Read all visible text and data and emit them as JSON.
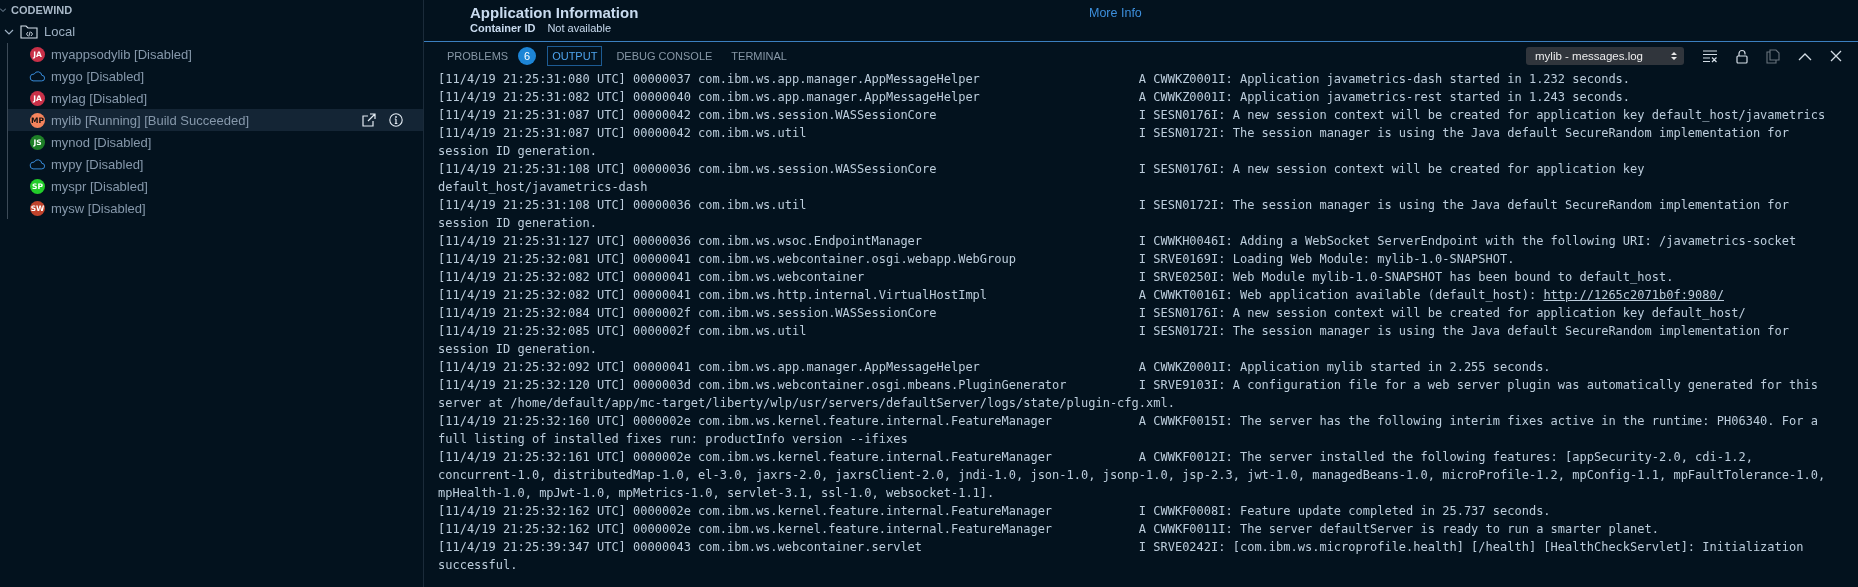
{
  "sidebar": {
    "title": "CODEWIND",
    "group": {
      "label": "Local",
      "expanded": true,
      "items": [
        {
          "kind": "badge",
          "badge": "JA",
          "color": "#c93048",
          "label": "myappsodylib [Disabled]",
          "selected": false
        },
        {
          "kind": "cloud",
          "label": "mygo [Disabled]",
          "selected": false
        },
        {
          "kind": "badge",
          "badge": "JA",
          "color": "#c93048",
          "label": "mylag [Disabled]",
          "selected": false
        },
        {
          "kind": "badge",
          "badge": "MP",
          "color": "#f5845c",
          "label": "mylib [Running] [Build Succeeded]",
          "selected": true
        },
        {
          "kind": "badge",
          "badge": "JS",
          "color": "#1e7f27",
          "label": "mynod [Disabled]",
          "selected": false
        },
        {
          "kind": "cloud",
          "label": "mypy [Disabled]",
          "selected": false
        },
        {
          "kind": "badge",
          "badge": "SP",
          "color": "#22cc2a",
          "label": "myspr [Disabled]",
          "selected": false
        },
        {
          "kind": "badge",
          "badge": "SW",
          "color": "#c0432c",
          "label": "mysw [Disabled]",
          "selected": false
        }
      ]
    }
  },
  "editor": {
    "heading": "Application Information",
    "link": "More Info",
    "field_label": "Container ID",
    "field_value": "Not available"
  },
  "panel": {
    "tabs": [
      {
        "label": "PROBLEMS",
        "badge": "6",
        "selected": false
      },
      {
        "label": "OUTPUT",
        "selected": true
      },
      {
        "label": "DEBUG CONSOLE",
        "selected": false
      },
      {
        "label": "TERMINAL",
        "selected": false
      }
    ],
    "channel": "mylib - messages.log",
    "log": [
      {
        "timestamp": "[11/4/19 21:25:31:080 UTC]",
        "thread": "00000037",
        "source": "com.ibm.ws.app.manager.AppMessageHelper",
        "severity": "A",
        "message": "CWWKZ0001I: Application javametrics-dash started in 1.232 seconds."
      },
      {
        "timestamp": "[11/4/19 21:25:31:082 UTC]",
        "thread": "00000040",
        "source": "com.ibm.ws.app.manager.AppMessageHelper",
        "severity": "A",
        "message": "CWWKZ0001I: Application javametrics-rest started in 1.243 seconds."
      },
      {
        "timestamp": "[11/4/19 21:25:31:087 UTC]",
        "thread": "00000042",
        "source": "com.ibm.ws.session.WASSessionCore",
        "severity": "I",
        "message": "SESN0176I: A new session context will be created for application key default_host/javametrics"
      },
      {
        "timestamp": "[11/4/19 21:25:31:087 UTC]",
        "thread": "00000042",
        "source": "com.ibm.ws.util",
        "severity": "I",
        "message": "SESN0172I: The session manager is using the Java default SecureRandom implementation for session ID generation."
      },
      {
        "timestamp": "[11/4/19 21:25:31:108 UTC]",
        "thread": "00000036",
        "source": "com.ibm.ws.session.WASSessionCore",
        "severity": "I",
        "message": "SESN0176I: A new session context will be created for application key default_host/javametrics-dash"
      },
      {
        "timestamp": "[11/4/19 21:25:31:108 UTC]",
        "thread": "00000036",
        "source": "com.ibm.ws.util",
        "severity": "I",
        "message": "SESN0172I: The session manager is using the Java default SecureRandom implementation for session ID generation."
      },
      {
        "timestamp": "[11/4/19 21:25:31:127 UTC]",
        "thread": "00000036",
        "source": "com.ibm.ws.wsoc.EndpointManager",
        "severity": "I",
        "message": "CWWKH0046I: Adding a WebSocket ServerEndpoint with the following URI: /javametrics-socket"
      },
      {
        "timestamp": "[11/4/19 21:25:32:081 UTC]",
        "thread": "00000041",
        "source": "com.ibm.ws.webcontainer.osgi.webapp.WebGroup",
        "severity": "I",
        "message": "SRVE0169I: Loading Web Module: mylib-1.0-SNAPSHOT."
      },
      {
        "timestamp": "[11/4/19 21:25:32:082 UTC]",
        "thread": "00000041",
        "source": "com.ibm.ws.webcontainer",
        "severity": "I",
        "message": "SRVE0250I: Web Module mylib-1.0-SNAPSHOT has been bound to default_host."
      },
      {
        "timestamp": "[11/4/19 21:25:32:082 UTC]",
        "thread": "00000041",
        "source": "com.ibm.ws.http.internal.VirtualHostImpl",
        "severity": "A",
        "message": "CWWKT0016I: Web application available (default_host):",
        "link": "http://1265c2071b0f:9080/"
      },
      {
        "timestamp": "[11/4/19 21:25:32:084 UTC]",
        "thread": "0000002f",
        "source": "com.ibm.ws.session.WASSessionCore",
        "severity": "I",
        "message": "SESN0176I: A new session context will be created for application key default_host/"
      },
      {
        "timestamp": "[11/4/19 21:25:32:085 UTC]",
        "thread": "0000002f",
        "source": "com.ibm.ws.util",
        "severity": "I",
        "message": "SESN0172I: The session manager is using the Java default SecureRandom implementation for session ID generation."
      },
      {
        "timestamp": "[11/4/19 21:25:32:092 UTC]",
        "thread": "00000041",
        "source": "com.ibm.ws.app.manager.AppMessageHelper",
        "severity": "A",
        "message": "CWWKZ0001I: Application mylib started in 2.255 seconds."
      },
      {
        "timestamp": "[11/4/19 21:25:32:120 UTC]",
        "thread": "0000003d",
        "source": "com.ibm.ws.webcontainer.osgi.mbeans.PluginGenerator",
        "severity": "I",
        "message": "SRVE9103I: A configuration file for a web server plugin was automatically generated for this server at /home/default/app/mc-target/liberty/wlp/usr/servers/defaultServer/logs/state/plugin-cfg.xml."
      },
      {
        "timestamp": "[11/4/19 21:25:32:160 UTC]",
        "thread": "0000002e",
        "source": "com.ibm.ws.kernel.feature.internal.FeatureManager",
        "severity": "A",
        "message": "CWWKF0015I: The server has the following interim fixes active in the runtime: PH06340. For a full listing of installed fixes run: productInfo version --ifixes"
      },
      {
        "timestamp": "[11/4/19 21:25:32:161 UTC]",
        "thread": "0000002e",
        "source": "com.ibm.ws.kernel.feature.internal.FeatureManager",
        "severity": "A",
        "message": "CWWKF0012I: The server installed the following features: [appSecurity-2.0, cdi-1.2, concurrent-1.0, distributedMap-1.0, el-3.0, jaxrs-2.0, jaxrsClient-2.0, jndi-1.0, json-1.0, jsonp-1.0, jsp-2.3, jwt-1.0, managedBeans-1.0, microProfile-1.2, mpConfig-1.1, mpFaultTolerance-1.0, mpHealth-1.0, mpJwt-1.0, mpMetrics-1.0, servlet-3.1, ssl-1.0, websocket-1.1]."
      },
      {
        "timestamp": "[11/4/19 21:25:32:162 UTC]",
        "thread": "0000002e",
        "source": "com.ibm.ws.kernel.feature.internal.FeatureManager",
        "severity": "I",
        "message": "CWWKF0008I: Feature update completed in 25.737 seconds."
      },
      {
        "timestamp": "[11/4/19 21:25:32:162 UTC]",
        "thread": "0000002e",
        "source": "com.ibm.ws.kernel.feature.internal.FeatureManager",
        "severity": "A",
        "message": "CWWKF0011I: The server defaultServer is ready to run a smarter planet."
      },
      {
        "timestamp": "[11/4/19 21:25:39:347 UTC]",
        "thread": "00000043",
        "source": "com.ibm.ws.webcontainer.servlet",
        "severity": "I",
        "message": "SRVE0242I: [com.ibm.ws.microprofile.health] [/health] [HealthCheckServlet]: Initialization successful."
      }
    ]
  }
}
